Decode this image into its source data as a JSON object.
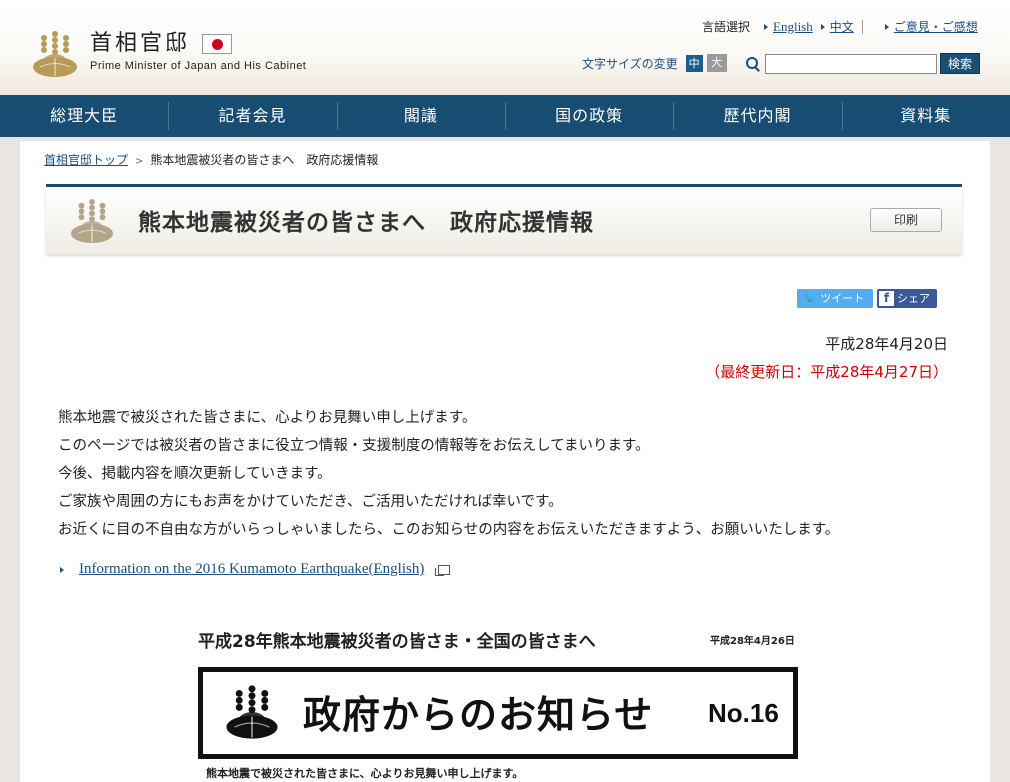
{
  "header": {
    "site_name_jp": "首相官邸",
    "site_name_en": "Prime Minister of Japan and His Cabinet",
    "language_label": "言語選択",
    "lang_english": "English",
    "lang_chinese": "中文",
    "feedback": "ご意見・ご感想",
    "font_size_label": "文字サイズの変更",
    "font_size_medium": "中",
    "font_size_large": "大",
    "search_placeholder": "",
    "search_button": "検索"
  },
  "nav": {
    "items": [
      {
        "label": "総理大臣"
      },
      {
        "label": "記者会見"
      },
      {
        "label": "閣議"
      },
      {
        "label": "国の政策"
      },
      {
        "label": "歴代内閣"
      },
      {
        "label": "資料集"
      }
    ]
  },
  "breadcrumb": {
    "home": "首相官邸トップ",
    "separator": ">",
    "current": "熊本地震被災者の皆さまへ　政府応援情報"
  },
  "page": {
    "title": "熊本地震被災者の皆さまへ　政府応援情報",
    "print_button": "印刷",
    "tweet_button": "ツイート",
    "share_button": "シェア",
    "share_icon": "f",
    "date": "平成28年4月20日",
    "last_updated": "（最終更新日：平成28年4月27日）",
    "intro_lines": [
      "熊本地震で被災された皆さまに、心よりお見舞い申し上げます。",
      "このページでは被災者の皆さまに役立つ情報・支援制度の情報等をお伝えしてまいります。",
      "今後、掲載内容を順次更新していきます。",
      "ご家族や周囲の方にもお声をかけていただき、ご活用いただければ幸いです。",
      "お近くに目の不自由な方がいらっしゃいましたら、このお知らせの内容をお伝えいただきますよう、お願いいたします。"
    ],
    "english_link": "Information on the 2016 Kumamoto Earthquake(English)"
  },
  "notice": {
    "heading": "平成28年熊本地震被災者の皆さま・全国の皆さまへ",
    "date": "平成28年4月26日",
    "title": "政府からのお知らせ",
    "number": "No.16",
    "body_line": "熊本地震で被災された皆さまに、心よりお見舞い申し上げます。"
  },
  "colors": {
    "nav_bg": "#174c73",
    "link": "#1b4f82",
    "update_red": "#cc0000"
  }
}
